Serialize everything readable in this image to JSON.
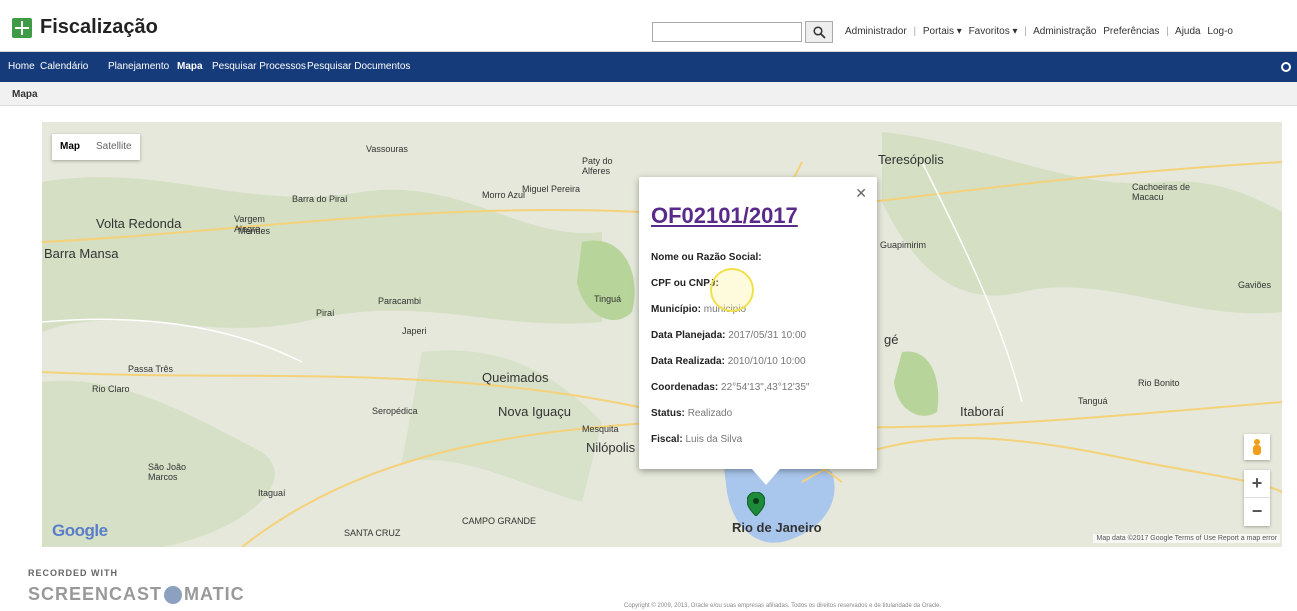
{
  "app": {
    "title": "Fiscalização"
  },
  "top_links": [
    "Administrador",
    "Portais ▾",
    "Favoritos ▾",
    "Administração",
    "Preferências",
    "Ajuda",
    "Log-o"
  ],
  "nav": {
    "items": [
      "Home",
      "Calendário",
      "Planejamento",
      "Mapa",
      "Pesquisar Processos",
      "Pesquisar Documentos"
    ],
    "active": "Mapa"
  },
  "breadcrumb": "Mapa",
  "map": {
    "type_map": "Map",
    "type_satellite": "Satellite",
    "google": "Google",
    "attribution": "Map data ©2017 Google   Terms of Use   Report a map error",
    "places": {
      "volta_redonda": "Volta Redonda",
      "barra_mansa": "Barra Mansa",
      "teresopolis": "Teresópolis",
      "queimados": "Queimados",
      "nova_iguacu": "Nova Iguaçu",
      "nilopolis": "Nilópolis",
      "itaborai": "Itaboraí",
      "rio": "Rio de Janeiro",
      "paracambi": "Paracambi",
      "pirai": "Piraí",
      "japeri": "Japeri",
      "seropedica": "Seropédica",
      "itaguai": "Itaguaí",
      "barra_do_pirai": "Barra do Piraí",
      "vassouras": "Vassouras",
      "miguel_pereira": "Miguel Pereira",
      "guapimirim": "Guapimirim",
      "cachoeiras": "Cachoeiras de Macacu",
      "rio_bonito": "Rio Bonito",
      "tangua": "Tanguá",
      "mendes": "Mendes",
      "rio_claro": "Rio Claro",
      "sao_joao": "São João Marcos",
      "mesquita": "Mesquita",
      "gavioes": "Gaviões",
      "tingua": "Tinguá",
      "paty": "Paty do Alferes",
      "vargem": "Vargem Alegre",
      "passa_tres": "Passa Três",
      "miguel_couto": "Morro Azul",
      "campo_grande": "CAMPO GRANDE",
      "santa_cruz": "SANTA CRUZ",
      "sao_goncalo": "gé"
    }
  },
  "info_window": {
    "title": "OF02101/2017",
    "rows": [
      {
        "label": "Nome ou Razão Social:",
        "value": ""
      },
      {
        "label": "CPF ou CNPJ:",
        "value": ""
      },
      {
        "label": "Município:",
        "value": "municipio"
      },
      {
        "label": "Data Planejada:",
        "value": "2017/05/31 10:00"
      },
      {
        "label": "Data Realizada:",
        "value": "2010/10/10 10:00"
      },
      {
        "label": "Coordenadas:",
        "value": "22°54'13\",43°12'35\""
      },
      {
        "label": "Status:",
        "value": "Realizado"
      },
      {
        "label": "Fiscal:",
        "value": "Luis da Silva"
      }
    ]
  },
  "footer": {
    "recorded": "RECORDED WITH",
    "brand_left": "SCREENCAST",
    "brand_right": "MATIC",
    "copyright": "Copyright © 2009, 2013, Oracle e/ou suas empresas afiliadas. Todos os direitos reservados e de titularidade da Oracle."
  }
}
